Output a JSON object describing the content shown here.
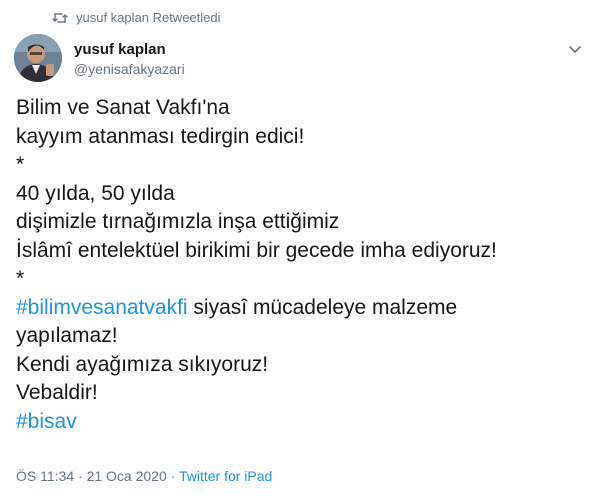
{
  "retweet": {
    "icon": "retweet-icon",
    "label": "yusuf kaplan Retweetledi"
  },
  "author": {
    "name": "yusuf kaplan",
    "handle": "@yenisafakyazari",
    "avatar_icon": "avatar"
  },
  "tweet": {
    "lines": [
      [
        "Bilim ve Sanat Vakfı'na"
      ],
      [
        "kayyım atanması tedirgin edici!"
      ],
      [
        "*"
      ],
      [
        "40 yılda, 50 yılda"
      ],
      [
        "dişimizle tırnağımızla inşa ettiğimiz"
      ],
      [
        "İslâmî entelektüel birikimi bir gecede imha ediyoruz!"
      ],
      [
        "*"
      ],
      [
        "#bilimvesanatvakfi",
        " siyasî mücadeleye malzeme"
      ],
      [
        "yapılamaz!"
      ],
      [
        "Kendi ayağımıza sıkıyoruz!"
      ],
      [
        "Vebaldir!"
      ],
      [
        "#bisav"
      ]
    ]
  },
  "meta": {
    "time": "ÖS 11:34",
    "separator": " · ",
    "date": "21 Oca 2020",
    "separator2": " · ",
    "source": "Twitter for iPad"
  },
  "colors": {
    "text": "#14171a",
    "muted": "#657786",
    "link": "#1b95e0"
  }
}
